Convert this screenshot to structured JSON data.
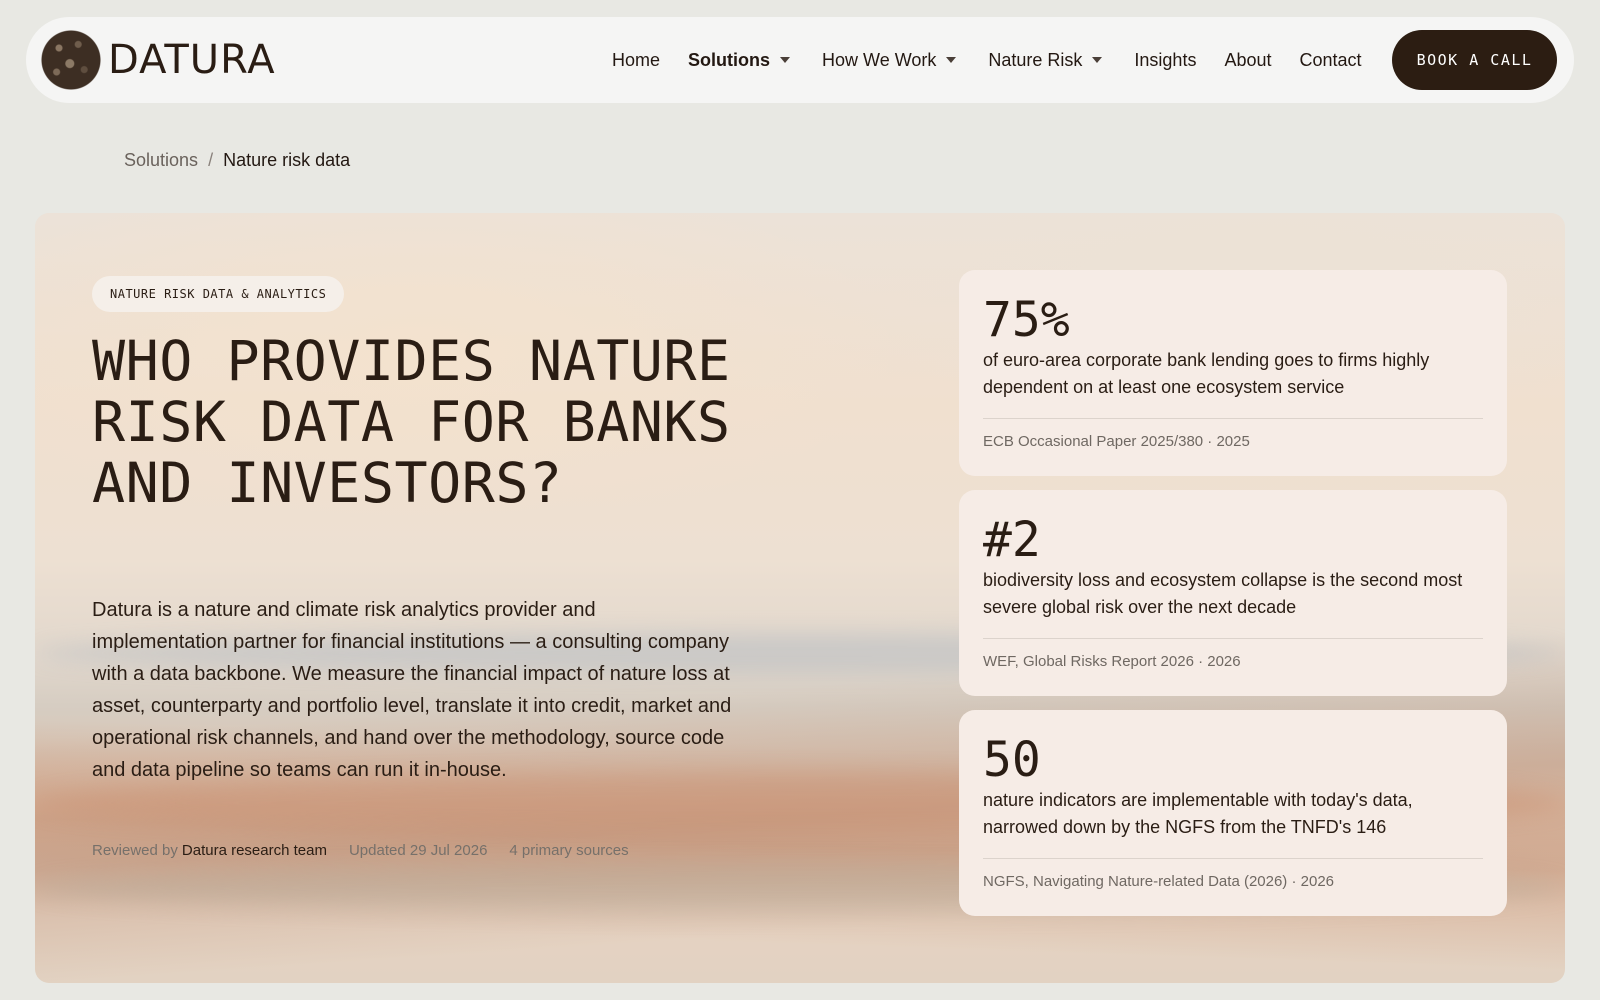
{
  "nav": {
    "brand": "DATURA",
    "items": [
      {
        "label": "Home",
        "dropdown": false,
        "active": false
      },
      {
        "label": "Solutions",
        "dropdown": true,
        "active": true
      },
      {
        "label": "How We Work",
        "dropdown": true,
        "active": false
      },
      {
        "label": "Nature Risk",
        "dropdown": true,
        "active": false
      },
      {
        "label": "Insights",
        "dropdown": false,
        "active": false
      },
      {
        "label": "About",
        "dropdown": false,
        "active": false
      },
      {
        "label": "Contact",
        "dropdown": false,
        "active": false
      }
    ],
    "cta": "BOOK A CALL"
  },
  "breadcrumb": {
    "parent": "Solutions",
    "separator": "/",
    "current": "Nature risk data"
  },
  "hero": {
    "tag": "NATURE RISK DATA & ANALYTICS",
    "title": "WHO PROVIDES NATURE RISK DATA FOR BANKS AND INVESTORS?",
    "body": "Datura is a nature and climate risk analytics provider and implementation partner for financial institutions — a consulting company with a data backbone. We measure the financial impact of nature loss at asset, counterparty and portfolio level, translate it into credit, market and operational risk channels, and hand over the methodology, source code and data pipeline so teams can run it in-house.",
    "meta": {
      "reviewed_prefix": "Reviewed by",
      "reviewer": "Datura research team",
      "updated": "Updated 29 Jul 2026",
      "sources": "4 primary sources"
    }
  },
  "stats": [
    {
      "value": "75%",
      "description": "of euro-area corporate bank lending goes to firms highly dependent on at least one ecosystem service",
      "source": "ECB Occasional Paper 2025/380 · 2025"
    },
    {
      "value": "#2",
      "description": "biodiversity loss and ecosystem collapse is the second most severe global risk over the next decade",
      "source": "WEF, Global Risks Report 2026 · 2026"
    },
    {
      "value": "50",
      "description": "nature indicators are implementable with today's data, narrowed down by the NGFS from the TNFD's 146",
      "source": "NGFS, Navigating Nature-related Data (2026) · 2026"
    }
  ],
  "colors": {
    "page_bg": "#e8e8e3",
    "nav_bg": "#f5f5f4",
    "text_dark": "#2a1d14",
    "cta_bg": "#2c1d12",
    "card_bg": "#f6ece6"
  }
}
